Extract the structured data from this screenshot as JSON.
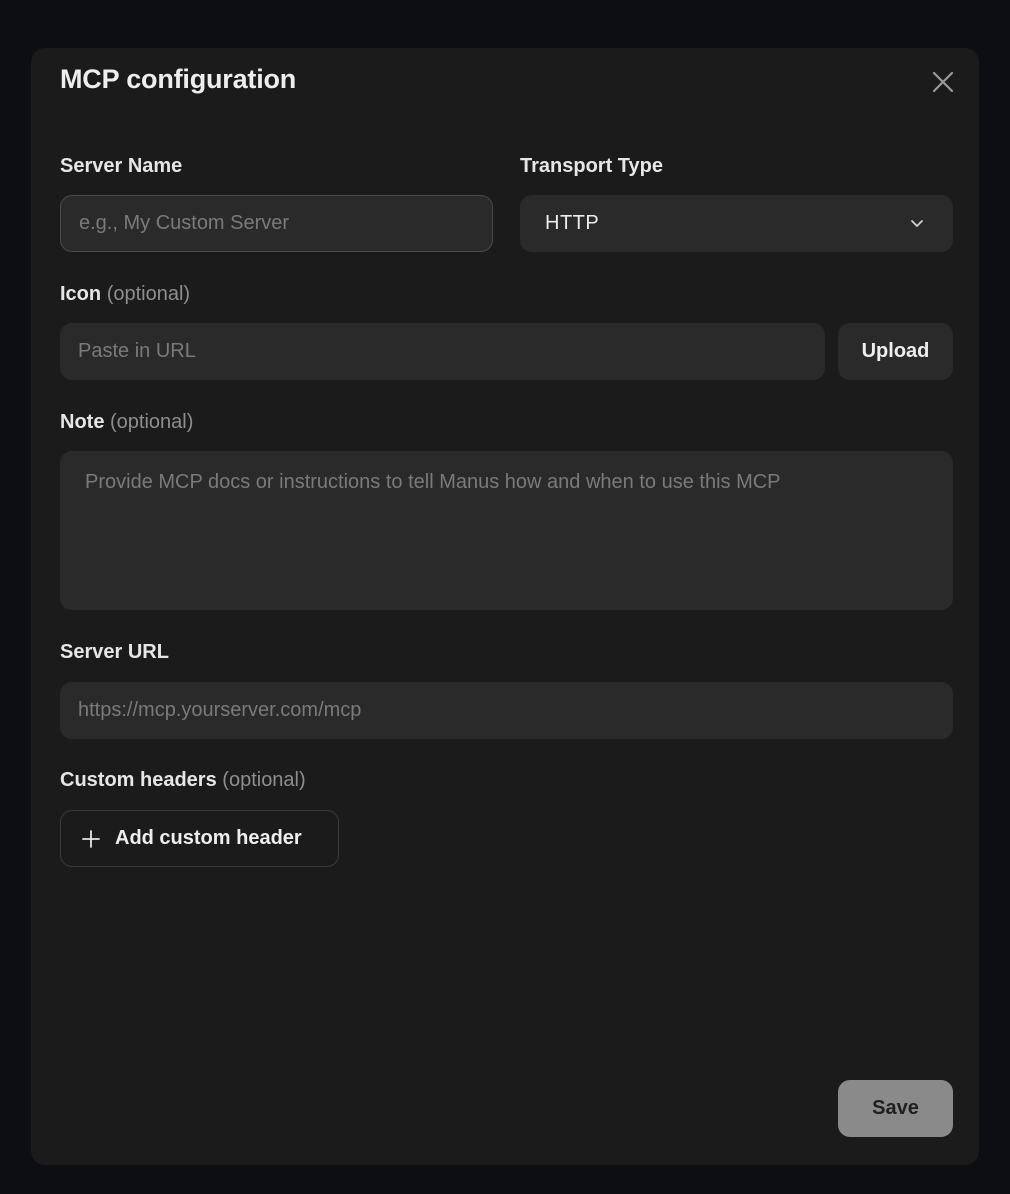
{
  "dialog": {
    "title": "MCP configuration"
  },
  "fields": {
    "server_name": {
      "label": "Server Name",
      "placeholder": "e.g., My Custom Server",
      "value": ""
    },
    "transport_type": {
      "label": "Transport Type",
      "value": "HTTP"
    },
    "icon": {
      "label": "Icon",
      "optional": "(optional)",
      "placeholder": "Paste in URL",
      "upload_label": "Upload"
    },
    "note": {
      "label": "Note",
      "optional": "(optional)",
      "placeholder": "Provide MCP docs or instructions to tell Manus how and when to use this MCP"
    },
    "server_url": {
      "label": "Server URL",
      "placeholder": "https://mcp.yourserver.com/mcp"
    },
    "custom_headers": {
      "label": "Custom headers",
      "optional": "(optional)",
      "add_label": "Add custom header"
    }
  },
  "actions": {
    "save_label": "Save"
  },
  "icons": {
    "close": "close-icon",
    "chevron": "chevron-down-icon",
    "plus": "plus-icon"
  },
  "colors": {
    "backdrop": "#0d0e12",
    "dialog_bg": "#1b1b1b",
    "field_bg": "#2a2a2a",
    "save_bg": "#8a8a8a"
  }
}
